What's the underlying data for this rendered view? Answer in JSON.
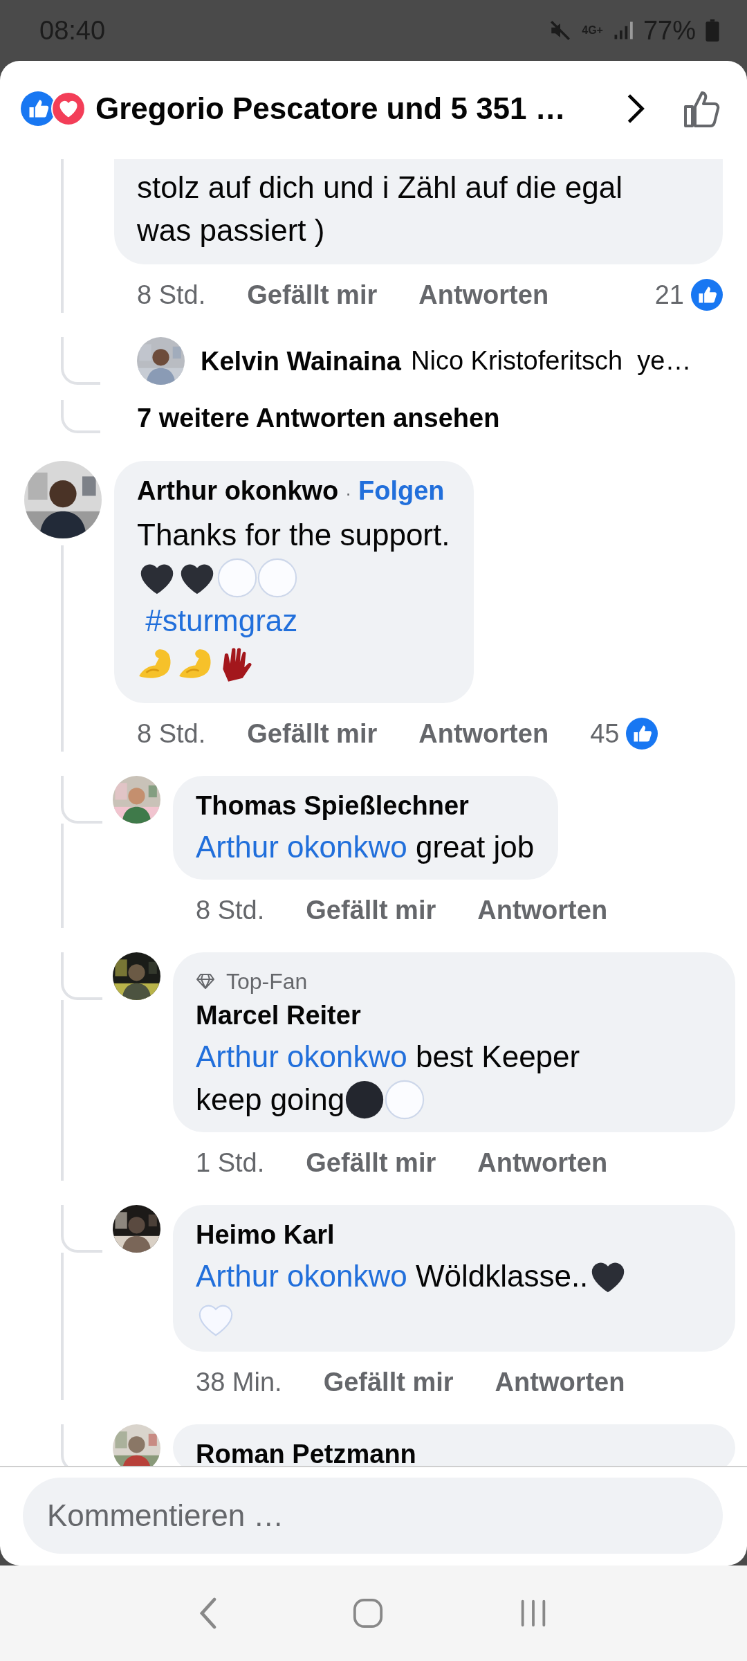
{
  "status_bar": {
    "time": "08:40",
    "network": "4G+",
    "battery": "77%"
  },
  "header": {
    "title": "Gregorio Pescatore und 5 351 …"
  },
  "items": [
    {
      "kind": "thread_reply",
      "body": [
        [
          {
            "kind": "text",
            "text": "stolz auf dich und i Zähl auf die egal"
          }
        ],
        [
          {
            "kind": "text",
            "text": "was passiert )"
          }
        ]
      ],
      "time": "8 Std.",
      "like": "Gefällt mir",
      "reply": "Antworten",
      "reaction_count": "21"
    },
    {
      "kind": "reply_preview",
      "author": "Kelvin Wainaina",
      "text": "Nico Kristoferitsch  ye…"
    },
    {
      "kind": "more_replies",
      "text": "7 weitere Antworten ansehen"
    },
    {
      "kind": "comment",
      "author": "Arthur okonkwo",
      "separator": "·",
      "follow": "Folgen",
      "body": [
        [
          {
            "kind": "text",
            "text": "Thanks for the support."
          }
        ],
        [
          {
            "kind": "black_heart"
          },
          {
            "kind": "black_heart"
          },
          {
            "kind": "white_circle"
          },
          {
            "kind": "white_circle"
          }
        ],
        [
          {
            "kind": "link",
            "text": " #sturmgraz"
          }
        ],
        [
          {
            "kind": "flexed_biceps"
          },
          {
            "kind": "flexed_biceps"
          },
          {
            "kind": "glove"
          }
        ]
      ],
      "time": "8 Std.",
      "like": "Gefällt mir",
      "reply": "Antworten",
      "reaction_count": "45"
    },
    {
      "kind": "reply",
      "author": "Thomas Spießlechner",
      "body": [
        [
          {
            "kind": "link",
            "text": "Arthur okonkwo"
          },
          {
            "kind": "text",
            "text": " great job"
          }
        ]
      ],
      "time": "8 Std.",
      "like": "Gefällt mir",
      "reply": "Antworten"
    },
    {
      "kind": "reply",
      "badge": "Top-Fan",
      "author": "Marcel Reiter",
      "body": [
        [
          {
            "kind": "link",
            "text": "Arthur okonkwo"
          },
          {
            "kind": "text",
            "text": " best Keeper"
          }
        ],
        [
          {
            "kind": "text",
            "text": "keep going"
          },
          {
            "kind": "black_circle"
          },
          {
            "kind": "white_circle"
          }
        ]
      ],
      "time": "1 Std.",
      "like": "Gefällt mir",
      "reply": "Antworten"
    },
    {
      "kind": "reply",
      "author": "Heimo Karl",
      "body": [
        [
          {
            "kind": "link",
            "text": "Arthur okonkwo"
          },
          {
            "kind": "text",
            "text": " Wöldklasse.."
          },
          {
            "kind": "black_heart"
          }
        ],
        [
          {
            "kind": "white_heart"
          }
        ]
      ],
      "time": "38 Min.",
      "like": "Gefällt mir",
      "reply": "Antworten"
    },
    {
      "kind": "reply",
      "author": "Roman Petzmann"
    }
  ],
  "composer": {
    "placeholder": "Kommentieren …"
  }
}
